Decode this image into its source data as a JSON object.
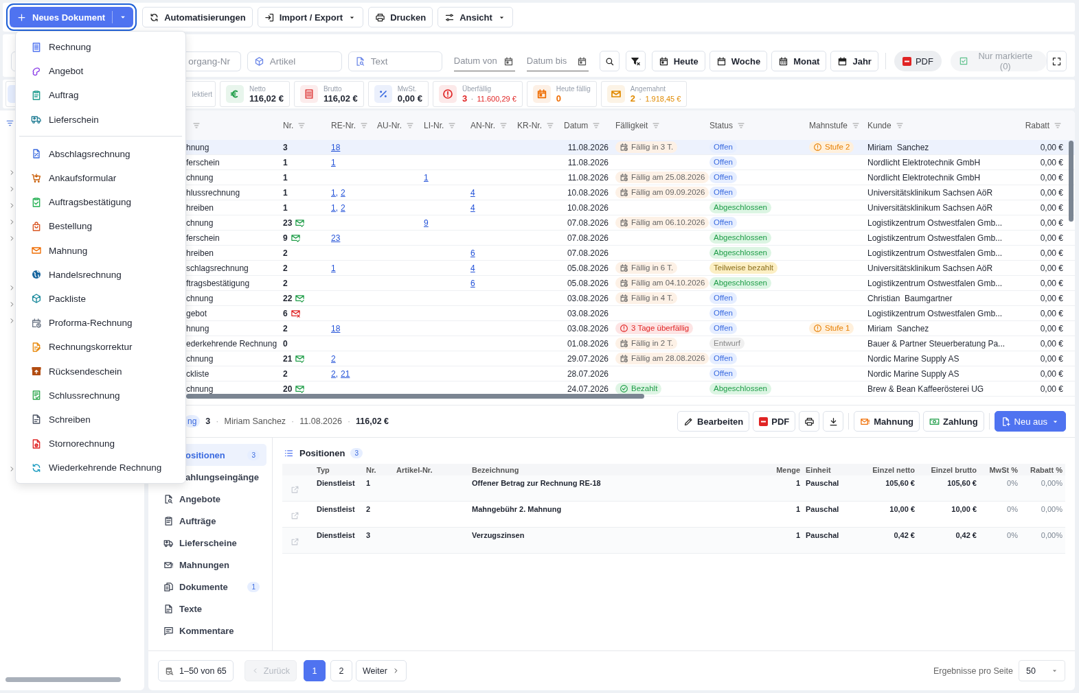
{
  "toolbar": {
    "new_button": {
      "label": "Neues Dokument"
    },
    "buttons": [
      {
        "label": "Automatisierungen",
        "kind": "automations",
        "dropdown": false
      },
      {
        "label": "Import / Export",
        "kind": "import",
        "dropdown": true
      },
      {
        "label": "Drucken",
        "kind": "print",
        "dropdown": false
      },
      {
        "label": "Ansicht",
        "kind": "view",
        "dropdown": true
      }
    ]
  },
  "filters": {
    "fields": [
      {
        "placeholder": "organg-Nr",
        "kind": "number"
      },
      {
        "placeholder": "Artikel",
        "kind": "article"
      },
      {
        "placeholder": "Text",
        "kind": "text"
      }
    ],
    "dates": [
      {
        "placeholder": "Datum von"
      },
      {
        "placeholder": "Datum bis"
      }
    ],
    "periods": [
      {
        "label": "Heute",
        "kind": "day"
      },
      {
        "label": "Woche",
        "kind": "week"
      },
      {
        "label": "Monat",
        "kind": "month"
      },
      {
        "label": "Jahr",
        "kind": "year"
      }
    ],
    "pdf": {
      "label": "PDF"
    },
    "marked": {
      "label": "Nur markierte (0)",
      "disabled": true
    }
  },
  "stats": [
    {
      "kind": "selected",
      "label": "lektiert"
    },
    {
      "kind": "netto",
      "label": "Netto",
      "value": "116,02 €",
      "color": "#1f9d48"
    },
    {
      "kind": "brutto",
      "label": "Brutto",
      "value": "116,02 €",
      "color": "#e04848"
    },
    {
      "kind": "tax",
      "label": "MwSt.",
      "value": "0,00 €",
      "color": "#3b6be0"
    },
    {
      "kind": "overdue",
      "label": "Überfällig",
      "value": "3",
      "separator": "·",
      "amount": "11.600,29 €",
      "color": "#e02424"
    },
    {
      "kind": "due_today",
      "label": "Heute fällig",
      "value": "0",
      "color": "#ef6c00"
    },
    {
      "kind": "dunned",
      "label": "Angemahnt",
      "value": "2",
      "separator": "·",
      "amount": "1.918,45 €",
      "color": "#e08a00"
    }
  ],
  "table": {
    "columns": [
      {
        "kind": "type"
      },
      {
        "label": "Nr."
      },
      {
        "label": "RE-Nr."
      },
      {
        "label": "AU-Nr."
      },
      {
        "label": "LI-Nr."
      },
      {
        "label": "AN-Nr."
      },
      {
        "label": "KR-Nr."
      },
      {
        "label": "Datum"
      },
      {
        "label": "Fälligkeit"
      },
      {
        "label": "Status"
      },
      {
        "label": "Mahnstufe"
      },
      {
        "label": "Kunde"
      },
      {
        "label": "Rabatt"
      }
    ],
    "rows": [
      {
        "selected": true,
        "type": "hnung",
        "nr": "3",
        "re": [
          "18"
        ],
        "date": "11.08.2026",
        "due": {
          "text": "Fällig in 3 T.",
          "kind": "due"
        },
        "status": {
          "text": "Offen",
          "kind": "open"
        },
        "dunning": "Stufe 2",
        "customer": "Miriam  Sanchez",
        "discount": "0,00 €"
      },
      {
        "selected": false,
        "type": "ferschein",
        "nr": "1",
        "re": [
          "1"
        ],
        "date": "11.08.2026",
        "status": {
          "text": "Offen",
          "kind": "open"
        },
        "customer": "Nordlicht Elektrotechnik GmbH",
        "discount": "0,00 €"
      },
      {
        "selected": false,
        "type": "chnung",
        "nr": "1",
        "li": [
          "1"
        ],
        "date": "11.08.2026",
        "due": {
          "text": "Fällig am 25.08.2026",
          "kind": "due"
        },
        "status": {
          "text": "Offen",
          "kind": "open"
        },
        "customer": "Nordlicht Elektrotechnik GmbH",
        "discount": "0,00 €"
      },
      {
        "selected": false,
        "type": "hlussrechnung",
        "nr": "1",
        "re": [
          "1,",
          "2"
        ],
        "an": [
          "4"
        ],
        "date": "10.08.2026",
        "due": {
          "text": "Fällig am 09.09.2026",
          "kind": "due"
        },
        "status": {
          "text": "Offen",
          "kind": "open"
        },
        "customer": "Universitätsklinikum Sachsen AöR",
        "discount": "0,00 €"
      },
      {
        "selected": false,
        "type": "hreiben",
        "nr": "1",
        "re": [
          "1,",
          "2"
        ],
        "an": [
          "4"
        ],
        "date": "10.08.2026",
        "status": {
          "text": "Abgeschlossen",
          "kind": "done"
        },
        "customer": "Universitätsklinikum Sachsen AöR",
        "discount": "0,00 €"
      },
      {
        "selected": false,
        "type": "chnung",
        "nr": "23",
        "mail": {
          "kind": "sent"
        },
        "li": [
          "9"
        ],
        "date": "07.08.2026",
        "due": {
          "text": "Fällig am 06.10.2026",
          "kind": "due"
        },
        "status": {
          "text": "Offen",
          "kind": "open"
        },
        "customer": "Logistikzentrum Ostwestfalen Gmb...",
        "discount": "0,00 €"
      },
      {
        "selected": false,
        "type": "ferschein",
        "nr": "9",
        "mail": {
          "kind": "sent"
        },
        "re": [
          "23"
        ],
        "date": "07.08.2026",
        "status": {
          "text": "Abgeschlossen",
          "kind": "done"
        },
        "customer": "Logistikzentrum Ostwestfalen Gmb...",
        "discount": "0,00 €"
      },
      {
        "selected": false,
        "type": "hreiben",
        "nr": "2",
        "an": [
          "6"
        ],
        "date": "07.08.2026",
        "status": {
          "text": "Abgeschlossen",
          "kind": "done"
        },
        "customer": "Logistikzentrum Ostwestfalen Gmb...",
        "discount": "0,00 €"
      },
      {
        "selected": false,
        "type": "schlagsrechnung",
        "nr": "2",
        "re": [
          "1"
        ],
        "an": [
          "4"
        ],
        "date": "05.08.2026",
        "due": {
          "text": "Fällig in 6 T.",
          "kind": "due"
        },
        "status": {
          "text": "Teilweise bezahlt",
          "kind": "partial"
        },
        "customer": "Universitätsklinikum Sachsen AöR",
        "discount": "0,00 €"
      },
      {
        "selected": false,
        "type": "ftragsbestätigung",
        "nr": "2",
        "an": [
          "6"
        ],
        "date": "05.08.2026",
        "due": {
          "text": "Fällig am 04.10.2026",
          "kind": "due"
        },
        "status": {
          "text": "Abgeschlossen",
          "kind": "done"
        },
        "customer": "Logistikzentrum Ostwestfalen Gmb...",
        "discount": "0,00 €"
      },
      {
        "selected": false,
        "type": "chnung",
        "nr": "22",
        "mail": {
          "kind": "sent"
        },
        "date": "03.08.2026",
        "due": {
          "text": "Fällig in 4 T.",
          "kind": "due"
        },
        "status": {
          "text": "Offen",
          "kind": "open"
        },
        "customer": "Christian  Baumgartner",
        "discount": "0,00 €"
      },
      {
        "selected": false,
        "type": "gebot",
        "nr": "6",
        "mail": {
          "kind": "failed"
        },
        "date": "03.08.2026",
        "status": {
          "text": "Offen",
          "kind": "open"
        },
        "customer": "Logistikzentrum Ostwestfalen Gmb...",
        "discount": "0,00 €"
      },
      {
        "selected": false,
        "type": "hnung",
        "nr": "2",
        "re": [
          "18"
        ],
        "date": "03.08.2026",
        "due": {
          "text": "3 Tage überfällig",
          "kind": "overdue"
        },
        "status": {
          "text": "Offen",
          "kind": "open"
        },
        "dunning": "Stufe 1",
        "customer": "Miriam  Sanchez",
        "discount": "0,00 €"
      },
      {
        "selected": false,
        "type": "ederkehrende Rechnung",
        "nr": "0",
        "date": "01.08.2026",
        "due": {
          "text": "Fällig in 2 T.",
          "kind": "due"
        },
        "status": {
          "text": "Entwurf",
          "kind": "draft"
        },
        "customer": "Bauer & Partner Steuerberatung Pa...",
        "discount": "0,00 €"
      },
      {
        "selected": false,
        "type": "chnung",
        "nr": "21",
        "mail": {
          "kind": "sent"
        },
        "re": [
          "2"
        ],
        "date": "29.07.2026",
        "due": {
          "text": "Fällig am 28.08.2026",
          "kind": "due"
        },
        "status": {
          "text": "Offen",
          "kind": "open"
        },
        "customer": "Nordic Marine Supply AS",
        "discount": "0,00 €"
      },
      {
        "selected": false,
        "type": "ckliste",
        "nr": "2",
        "re": [
          "2,",
          "21"
        ],
        "date": "28.07.2026",
        "status": {
          "text": "Offen",
          "kind": "open"
        },
        "customer": "Nordic Marine Supply AS",
        "discount": "0,00 €"
      },
      {
        "selected": false,
        "type": "chnung",
        "nr": "20",
        "mail": {
          "kind": "sent"
        },
        "date": "24.07.2026",
        "due": {
          "text": "Bezahlt",
          "kind": "paid"
        },
        "status": {
          "text": "Abgeschlossen",
          "kind": "done"
        },
        "customer": "Brew & Bean Kaffeerösterei UG",
        "discount": "0,00 €"
      }
    ]
  },
  "detail": {
    "badge": "ng",
    "parts": [
      {
        "text": "3",
        "kind": "number"
      },
      {
        "text": "·",
        "kind": "sep"
      },
      {
        "text": "Miriam Sanchez",
        "kind": "plain"
      },
      {
        "text": "·",
        "kind": "sep"
      },
      {
        "text": "11.08.2026",
        "kind": "plain"
      },
      {
        "text": "·",
        "kind": "sep"
      },
      {
        "text": "116,02 €",
        "kind": "number"
      }
    ],
    "actions": [
      {
        "kind": "edit",
        "label": "Bearbeiten"
      },
      {
        "kind": "pdf",
        "label": "PDF"
      },
      {
        "kind": "print"
      },
      {
        "kind": "download"
      },
      {
        "kind": "dunning",
        "label": "Mahnung"
      },
      {
        "kind": "payment",
        "label": "Zahlung"
      },
      {
        "kind": "new",
        "label": "Neu aus"
      }
    ],
    "nav": [
      {
        "label": "ositionen",
        "count": "3",
        "selected": true
      },
      {
        "label": "ahlungseingänge",
        "selected": false
      },
      {
        "label": "Angebote",
        "kind": "quotes",
        "selected": false
      },
      {
        "label": "Aufträge",
        "kind": "orders",
        "selected": false
      },
      {
        "label": "Lieferscheine",
        "kind": "deliveries",
        "selected": false
      },
      {
        "label": "Mahnungen",
        "kind": "dunnings",
        "selected": false
      },
      {
        "label": "Dokumente",
        "kind": "documents",
        "count": "1",
        "selected": false
      },
      {
        "label": "Texte",
        "kind": "texts",
        "selected": false
      },
      {
        "label": "Kommentare",
        "kind": "comments",
        "selected": false
      }
    ],
    "positions": {
      "title": "Positionen",
      "count": "3",
      "columns": [
        "Typ",
        "Nr.",
        "Artikel-Nr.",
        "Bezeichnung",
        "Menge",
        "Einheit",
        "Einzel netto",
        "Einzel brutto",
        "MwSt %",
        "Rabatt %"
      ],
      "rows": [
        {
          "type": "Dienstleist",
          "nr": "1",
          "name": "Offener Betrag zur Rechnung RE-18",
          "qty": "1",
          "unit": "Pauschal",
          "net": "105,60 €",
          "gross": "105,60 €",
          "vat": "0%",
          "discount": "0,00%"
        },
        {
          "type": "Dienstleist",
          "nr": "2",
          "name": "Mahngebühr 2. Mahnung",
          "qty": "1",
          "unit": "Pauschal",
          "net": "10,00 €",
          "gross": "10,00 €",
          "vat": "0%",
          "discount": "0,00%"
        },
        {
          "type": "Dienstleist",
          "nr": "3",
          "name": "Verzugszinsen",
          "qty": "1",
          "unit": "Pauschal",
          "net": "0,42 €",
          "gross": "0,42 €",
          "vat": "0%",
          "discount": "0,00%"
        }
      ]
    }
  },
  "pager": {
    "range": "1–50 von 65",
    "prev": {
      "label": "Zurück",
      "disabled": true
    },
    "pages": [
      {
        "label": "1",
        "selected": true
      },
      {
        "label": "2",
        "selected": false
      }
    ],
    "next": {
      "label": "Weiter"
    },
    "per_page_label": "Ergebnisse pro Seite",
    "per_page": "50"
  },
  "menu": {
    "groups": [
      [
        {
          "label": "Rechnung",
          "kind": "invoice"
        },
        {
          "label": "Angebot",
          "kind": "quote"
        },
        {
          "label": "Auftrag",
          "kind": "order"
        },
        {
          "label": "Lieferschein",
          "kind": "delivery"
        }
      ],
      [
        {
          "label": "Abschlagsrechnung",
          "kind": "partial"
        },
        {
          "label": "Ankaufsformular",
          "kind": "purchase"
        },
        {
          "label": "Auftragsbestätigung",
          "kind": "confirmation"
        },
        {
          "label": "Bestellung",
          "kind": "bag"
        },
        {
          "label": "Mahnung",
          "kind": "dunning"
        },
        {
          "label": "Handelsrechnung",
          "kind": "commercial"
        },
        {
          "label": "Packliste",
          "kind": "packing"
        },
        {
          "label": "Proforma-Rechnung",
          "kind": "proforma"
        },
        {
          "label": "Rechnungskorrektur",
          "kind": "correction"
        },
        {
          "label": "Rücksendeschein",
          "kind": "return"
        },
        {
          "label": "Schlussrechnung",
          "kind": "final"
        },
        {
          "label": "Schreiben",
          "kind": "letter"
        },
        {
          "label": "Stornorechnung",
          "kind": "cancel"
        },
        {
          "label": "Wiederkehrende Rechnung",
          "kind": "recurring"
        }
      ]
    ]
  }
}
